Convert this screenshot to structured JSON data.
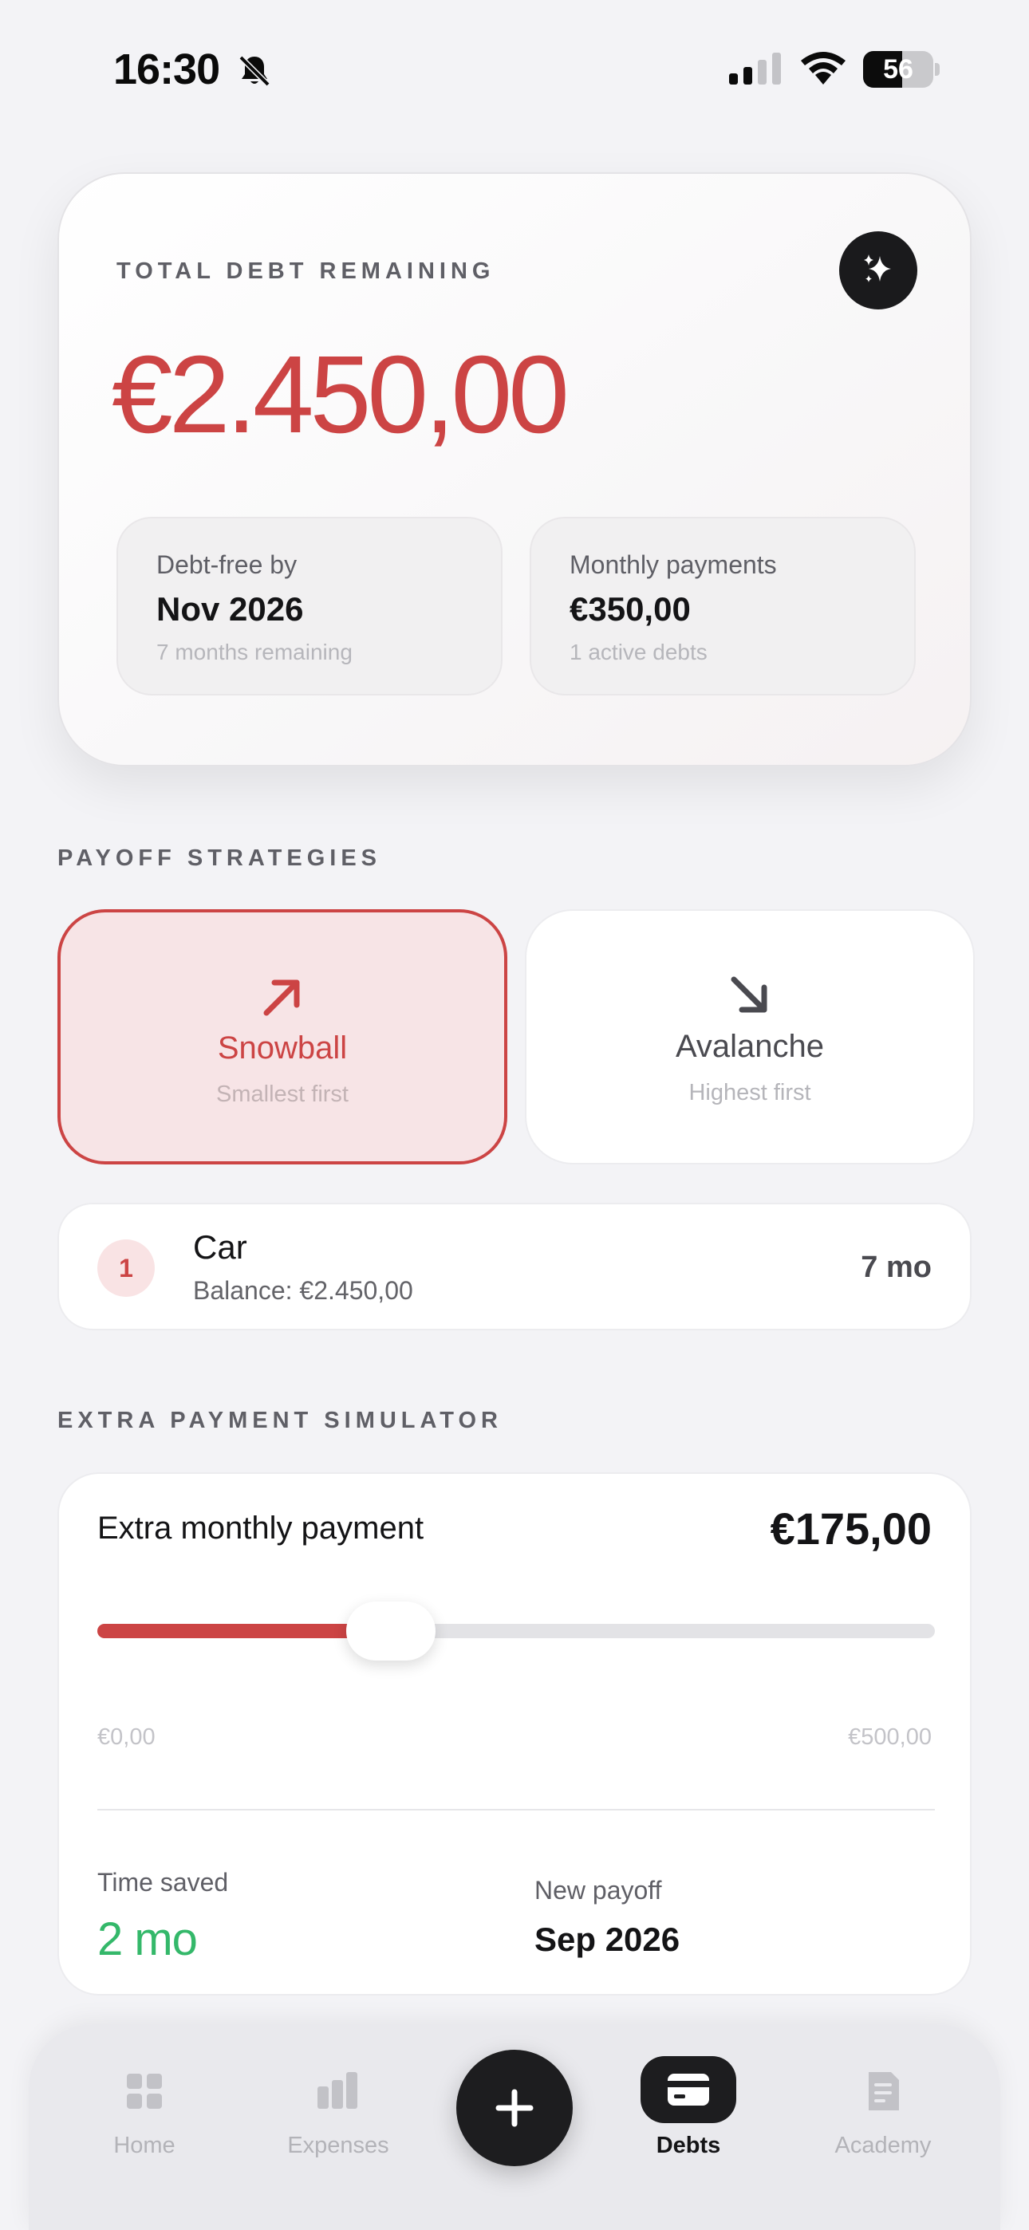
{
  "status_bar": {
    "time": "16:30",
    "battery": "56",
    "battery_level": 0.56
  },
  "debt_card": {
    "eyebrow": "TOTAL DEBT REMAINING",
    "total": "€2.450,00",
    "accent_color": "#cc4444",
    "debt_free": {
      "label": "Debt-free by",
      "value": "Nov 2026",
      "sub": "7 months remaining"
    },
    "monthly": {
      "label": "Monthly payments",
      "value": "€350,00",
      "sub": "1 active debts"
    }
  },
  "strategies": {
    "title": "PAYOFF STRATEGIES",
    "options": [
      {
        "name": "Snowball",
        "sub": "Smallest first",
        "icon": "arrow-up-right-icon",
        "selected": true
      },
      {
        "name": "Avalanche",
        "sub": "Highest first",
        "icon": "arrow-down-right-icon",
        "selected": false
      }
    ]
  },
  "debts": [
    {
      "rank": "1",
      "name": "Car",
      "balance": "Balance: €2.450,00",
      "months": "7 mo"
    }
  ],
  "simulator": {
    "title": "EXTRA PAYMENT SIMULATOR",
    "label": "Extra monthly payment",
    "amount": "€175,00",
    "slider_fraction": 0.35,
    "min": "€0,00",
    "max": "€500,00",
    "time_saved_label": "Time saved",
    "time_saved_value": "2 mo",
    "time_saved_color": "#34b86a",
    "new_payoff_label": "New payoff",
    "new_payoff_value": "Sep 2026"
  },
  "tab_bar": {
    "tabs": [
      {
        "label": "Home",
        "icon": "grid-icon",
        "active": false
      },
      {
        "label": "Expenses",
        "icon": "bar-chart-icon",
        "active": false
      },
      {
        "label": "Debts",
        "icon": "credit-card-icon",
        "active": true
      },
      {
        "label": "Academy",
        "icon": "document-icon",
        "active": false
      }
    ],
    "fab_icon": "plus-icon"
  }
}
